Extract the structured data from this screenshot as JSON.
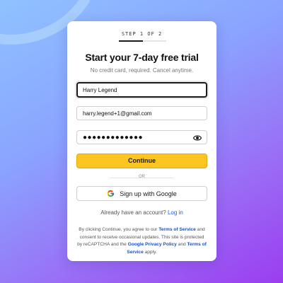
{
  "step_label": "STEP 1 OF 2",
  "progress_fraction": 0.5,
  "title": "Start your 7-day free trial",
  "subtitle": "No credit card, required. Cancel anytime.",
  "fields": {
    "name": {
      "value": "Harry Legend"
    },
    "email": {
      "value": "harry.legend+1@gmail.com"
    },
    "password": {
      "masked_value": "●●●●●●●●●●●●●"
    }
  },
  "continue_label": "Continue",
  "or_label": "OR",
  "google_label": "Sign up with Google",
  "signin": {
    "prompt": "Already have an account?",
    "link": "Log in"
  },
  "legal": {
    "p1": "By clicking Continue, you agree to our ",
    "tos1": "Terms of Service",
    "p2": " and consent to receive occasional updates. This site is protected by reCAPTCHA and the ",
    "privacy": "Google Privacy Policy",
    "p3": " and ",
    "tos2": "Terms of Service",
    "p4": " apply."
  },
  "colors": {
    "accent_yellow": "#fcc522",
    "link_blue": "#1f5fd8",
    "bg_top": "#8fc2ff",
    "bg_bottom": "#9b3df0"
  },
  "icons": {
    "password_toggle": "eye-icon",
    "google": "google-g-icon"
  }
}
